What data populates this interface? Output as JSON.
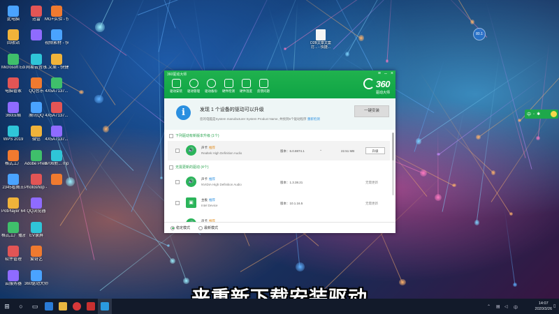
{
  "desktop": {
    "icons_col1": [
      "此电脑",
      "回收站",
      "Microsoft Edge",
      "电脑管家",
      "360压缩",
      "WPS 2019",
      "格式工厂",
      "2345看图王",
      "PotPlayer 64 bit",
      "格式工厂播放器",
      "软件管理",
      "云服务器"
    ],
    "icons_col2": [
      "迅雷",
      "",
      "网易云音乐",
      "QQ音乐",
      "腾讯QQ",
      "微信",
      "Adobe Premiere ...",
      "Photoshop - 快捷方式",
      "QQ浏览器",
      "EV录屏",
      "爱奇艺",
      "360驱动大师"
    ],
    "icons_col3": [
      "MG+实验 - 快捷方式",
      "视频素材 - 快捷方式",
      "1.文案 - 快捷方式",
      "4X5A7137...",
      "4X5A7137...",
      "4X5A7137...",
      "8706新... mp4",
      ""
    ],
    "file_right": "D2B文章文案打... - 快捷..."
  },
  "window": {
    "title": "360驱动大师",
    "tabs": [
      "驱动安装",
      "驱动管理",
      "驱动备份",
      "硬件检测",
      "硬件温度",
      "反馈问题"
    ],
    "brand_main": "360",
    "brand_sub": "驱动大师",
    "summary_title": "发现 1 个设备的驱动可以升级",
    "summary_sub": "您的电脑是System manufacturer System Product Name, 共找到5个驱动程序",
    "summary_link": "重新检测",
    "one_click_label": "一键安装",
    "group_upgrade": "下列驱动有新版本升级 (1个)",
    "group_latest": "无需更新的驱动 (4个)",
    "rows": [
      {
        "category": "声卡",
        "tag": "推荐",
        "name": "Realtek High Definition Audio",
        "version": "版本：6.0.8874.1",
        "size": "22.51 MB",
        "action": "升级",
        "icon": "🔊"
      },
      {
        "category": "声卡",
        "tag": "推荐",
        "name": "NVIDIA High Definition Audio",
        "version": "版本：1.3.38.21",
        "status": "无需更新",
        "icon": "🔊"
      },
      {
        "category": "主板",
        "tag": "推荐",
        "name": "Intel Device",
        "version": "版本：10.1.16.5",
        "status": "无需更新",
        "icon": "▣"
      },
      {
        "category": "声卡",
        "tag": "推荐",
        "name": "",
        "version": "",
        "status": "",
        "icon": "🔊"
      }
    ],
    "mode_stable": "稳定模式",
    "mode_latest": "最新模式"
  },
  "overlay": {
    "float_ball": "80.1",
    "ime_label": "中",
    "subtitle": "来重新下载安装驱动"
  },
  "taskbar": {
    "time": "14:07",
    "date": "2020/3/26"
  }
}
